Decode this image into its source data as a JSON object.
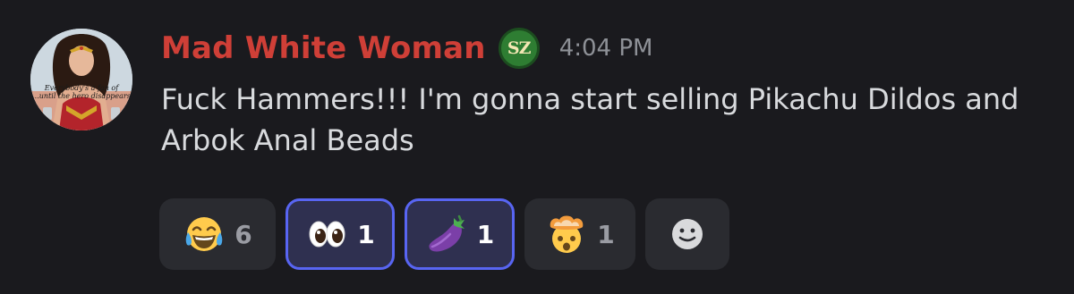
{
  "message": {
    "author": "Mad White Woman",
    "author_color": "#cf3f37",
    "role_icon": {
      "name": "sz-badge-icon",
      "label": "SZ",
      "color": "#2e7d32"
    },
    "timestamp": "4:04 PM",
    "content": "Fuck Hammers!!! I'm gonna start selling Pikachu Dildos and Arbok Anal Beads",
    "avatar": {
      "icon": "avatar-wonder-woman-image",
      "caption_line1": "Everybody's a fan of",
      "caption_line2": "...until the hero disappears"
    }
  },
  "reactions": [
    {
      "emoji": "face-with-tears-of-joy",
      "count": "6",
      "reacted": false
    },
    {
      "emoji": "eyes",
      "count": "1",
      "reacted": true
    },
    {
      "emoji": "eggplant",
      "count": "1",
      "reacted": true
    },
    {
      "emoji": "exploding-head",
      "count": "1",
      "reacted": false
    }
  ],
  "add_reaction": {
    "icon": "add-reaction-smiley-icon"
  },
  "colors": {
    "background": "#1a1a1e",
    "reaction_bg": "#2a2b30",
    "reacted_bg": "#2f3050",
    "reacted_border": "#5865f2",
    "text": "#d8dadd",
    "timestamp": "#8e9197"
  }
}
